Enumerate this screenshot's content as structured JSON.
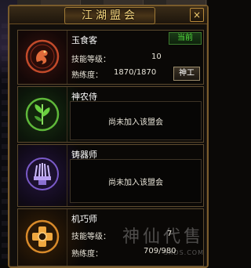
{
  "window": {
    "title": "江湖盟会",
    "close_label": "×"
  },
  "guilds": [
    {
      "name": "玉食客",
      "status": "当前",
      "skill_level_label": "技能等级：",
      "skill_level": "10",
      "proficiency_label": "熟练度：",
      "proficiency": "1870/1870",
      "action_label": "神工",
      "emblem_icon": "dragon-emblem-icon",
      "color": "#c24a2a"
    },
    {
      "name": "神农侍",
      "not_joined": "尚未加入该盟会",
      "emblem_icon": "herb-emblem-icon",
      "color": "#5fb83a"
    },
    {
      "name": "铸器师",
      "not_joined": "尚未加入该盟会",
      "emblem_icon": "anvil-emblem-icon",
      "color": "#7a5ac8"
    },
    {
      "name": "机巧师",
      "skill_level_label": "技能等级：",
      "skill_level": "7",
      "proficiency_label": "熟练度：",
      "proficiency": "709/980",
      "emblem_icon": "gear-emblem-icon",
      "color": "#d88a2a"
    }
  ],
  "watermark": {
    "text": "神仙代售",
    "sub": "SXDS.COM"
  }
}
